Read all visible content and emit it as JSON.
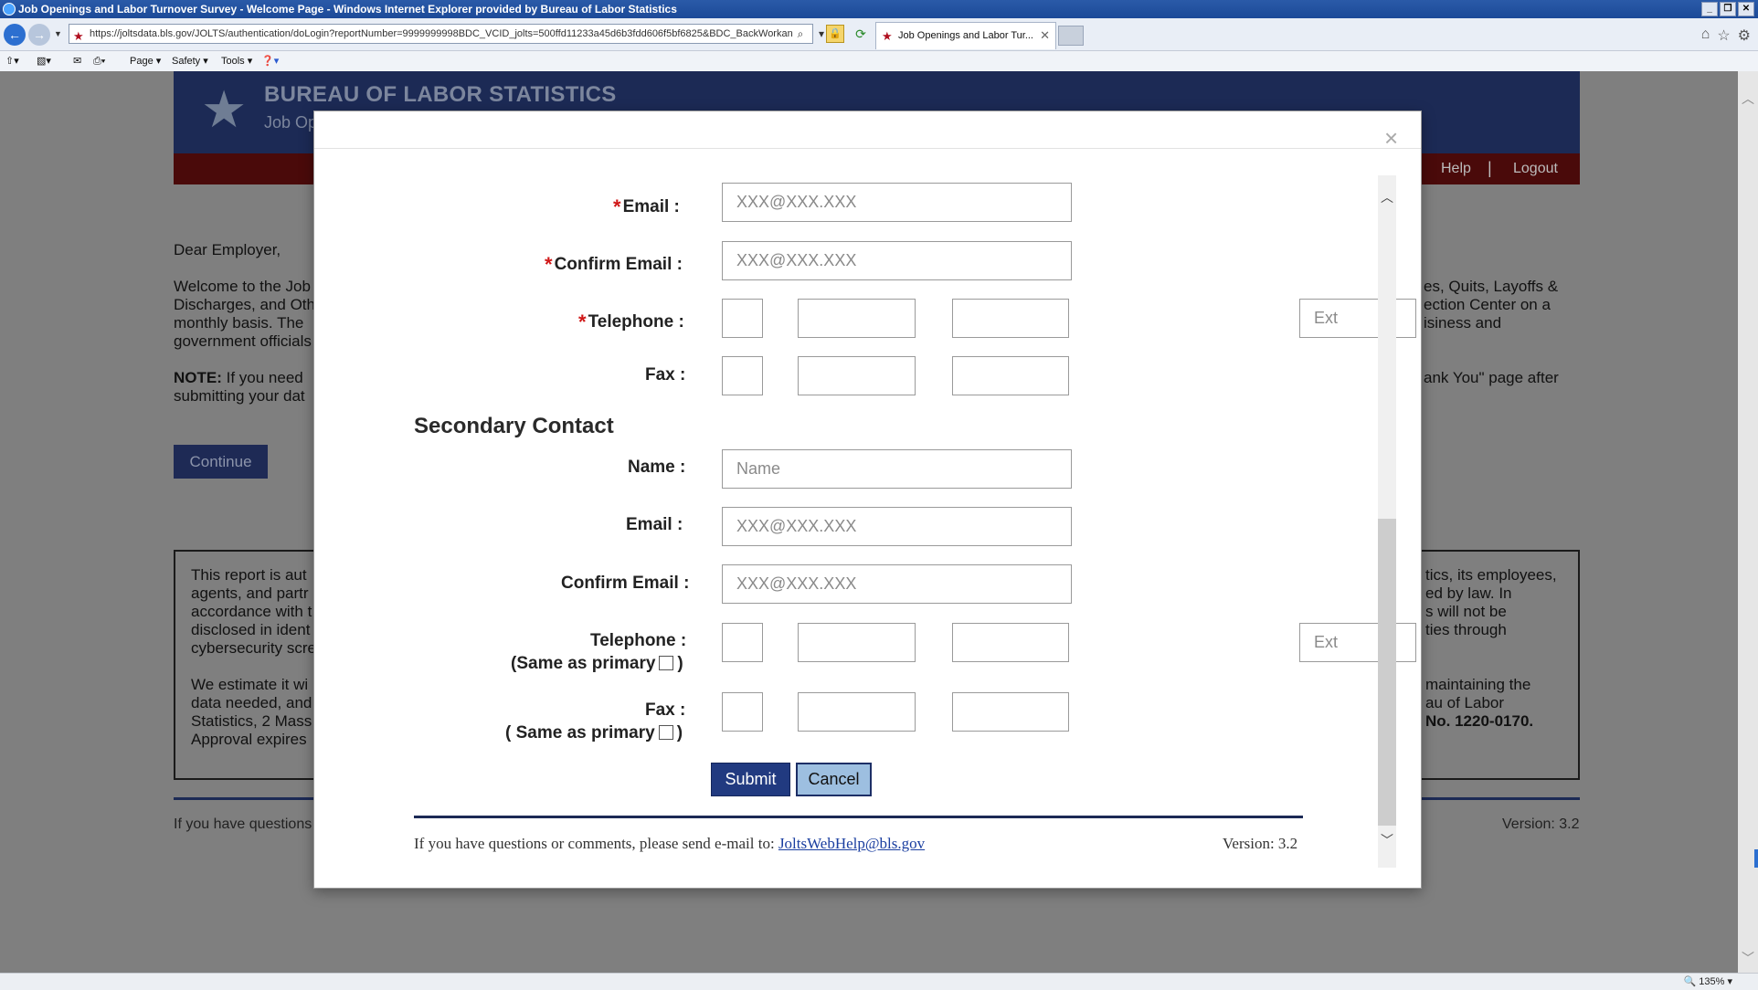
{
  "browser": {
    "title": "Job Openings and Labor Turnover Survey - Welcome Page - Windows Internet Explorer provided by Bureau of Labor Statistics",
    "url": "https://joltsdata.bls.gov/JOLTS/authentication/doLogin?reportNumber=9999999998BDC_VCID_jolts=500ffd11233a45d6b3fdd606f5bf6825&BDC_BackWorkan",
    "tab_label": "Job Openings and Labor Tur...",
    "command_bar": {
      "page": "Page",
      "safety": "Safety",
      "tools": "Tools"
    },
    "zoom": "135%"
  },
  "site": {
    "title": "BUREAU OF LABOR STATISTICS",
    "subtitle": "Job Op",
    "nav": {
      "help": "Help",
      "sep": "|",
      "logout": "Logout"
    },
    "greeting": "Dear Employer,",
    "welcome_left": "Welcome to the Job",
    "welcome_left_2": "Discharges, and Oth",
    "welcome_left_3": "monthly basis. The",
    "welcome_left_4": "government officials",
    "welcome_right": "es, Quits, Layoffs &",
    "welcome_right_2": "ection Center on a",
    "welcome_right_3": "isiness and",
    "note_label": "NOTE:",
    "note_left": " If you need",
    "note_left_2": "submitting your dat",
    "note_right": "ank You\" page after",
    "continue": "Continue",
    "notice_left": [
      "This report is aut",
      "agents, and partr",
      "accordance with t",
      "disclosed in ident",
      "cybersecurity scre",
      "",
      "We estimate it wi",
      "data needed, and",
      "Statistics, 2 Mass",
      "Approval expires"
    ],
    "notice_right": [
      "tics, its employees,",
      "ed by law. In",
      "s will not be",
      "ties through",
      "",
      "",
      "maintaining the",
      "au of Labor",
      "No. 1220-0170."
    ],
    "footer_left": "If you have questions",
    "footer_right": "Version: 3.2"
  },
  "modal": {
    "close": "×",
    "email_label": "Email :",
    "confirm_email_label": "Confirm Email :",
    "telephone_label": "Telephone :",
    "fax_label": "Fax :",
    "required_mark": "*",
    "email_placeholder": "XXX@XXX.XXX",
    "ext_placeholder": "Ext",
    "secondary_title": "Secondary Contact",
    "name_label": "Name :",
    "name_placeholder": "Name",
    "same_as_primary_tel": "(Same as primary",
    "same_as_primary_fax": "( Same as primary",
    "close_paren": ")",
    "submit": "Submit",
    "cancel": "Cancel",
    "footer_text": "If you have questions or comments, please send e-mail to: ",
    "footer_email": "JoltsWebHelp@bls.gov",
    "version": "Version: 3.2"
  }
}
